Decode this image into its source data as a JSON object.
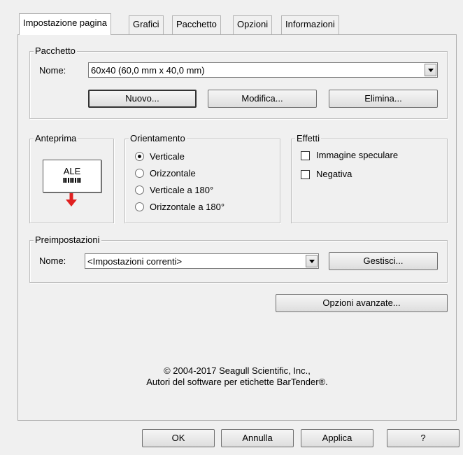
{
  "tabs": [
    {
      "label": "Impostazione pagina",
      "active": true
    },
    {
      "label": "Grafici"
    },
    {
      "label": "Pacchetto"
    },
    {
      "label": "Opzioni"
    },
    {
      "label": "Informazioni"
    }
  ],
  "pacchetto": {
    "legend": "Pacchetto",
    "name_label": "Nome:",
    "name_value": "60x40 (60,0 mm x 40,0 mm)",
    "new_button": "Nuovo...",
    "edit_button": "Modifica...",
    "delete_button": "Elimina..."
  },
  "anteprima": {
    "legend": "Anteprima",
    "card_text": "ALE"
  },
  "orientamento": {
    "legend": "Orientamento",
    "options": [
      "Verticale",
      "Orizzontale",
      "Verticale a 180°",
      "Orizzontale a 180°"
    ],
    "selected": 0
  },
  "effetti": {
    "legend": "Effetti",
    "mirror_label": "Immagine speculare",
    "negative_label": "Negativa"
  },
  "preimpostazioni": {
    "legend": "Preimpostazioni",
    "name_label": "Nome:",
    "name_value": "<Impostazioni correnti>",
    "manage_button": "Gestisci..."
  },
  "advanced_button": "Opzioni avanzate...",
  "copyright": {
    "line1": "© 2004-2017 Seagull Scientific, Inc.,",
    "line2": "Autori del software per etichette BarTender®."
  },
  "footer": {
    "ok": "OK",
    "cancel": "Annulla",
    "apply": "Applica",
    "help": "?"
  },
  "colors": {
    "preview_arrow": "#e02020"
  }
}
